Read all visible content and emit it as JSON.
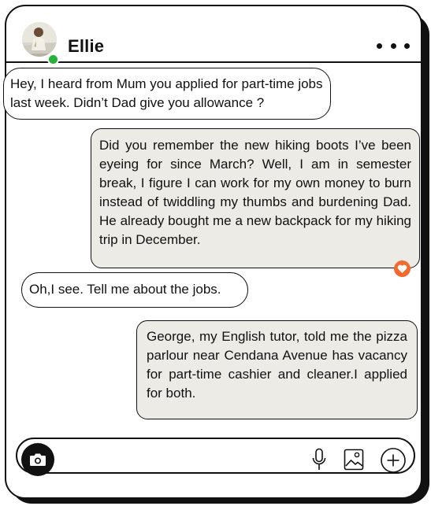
{
  "header": {
    "contact_name": "Ellie",
    "status": "online",
    "more_icon": "more-horizontal-icon"
  },
  "messages": [
    {
      "side": "incoming",
      "text": "Hey, I heard from Mum you applied for  part-time jobs last week. Didn’t Dad give you allowance ?"
    },
    {
      "side": "outgoing",
      "text": "Did you remember the new hiking boots I’ve been eyeing for since March? Well, I am in semester break, I figure I can work for my own money to burn instead of twiddling my thumbs and burdening Dad. He already bought me a new backpack for my hiking trip in December.",
      "reaction": "heart-icon"
    },
    {
      "side": "incoming",
      "text": "Oh,I see. Tell me about the jobs."
    },
    {
      "side": "outgoing",
      "text": "George, my English tutor, told me the pizza parlour near Cendana Avenue has vacancy for part-time cashier and cleaner.I applied for both."
    }
  ],
  "composer": {
    "icons": [
      "camera-icon",
      "microphone-icon",
      "image-icon",
      "plus-icon"
    ]
  },
  "colors": {
    "outgoing_bubble": "#ecebe6",
    "incoming_bubble": "#ffffff",
    "reaction": "#f26a2e",
    "online": "#27b23a",
    "outline": "#111111"
  }
}
